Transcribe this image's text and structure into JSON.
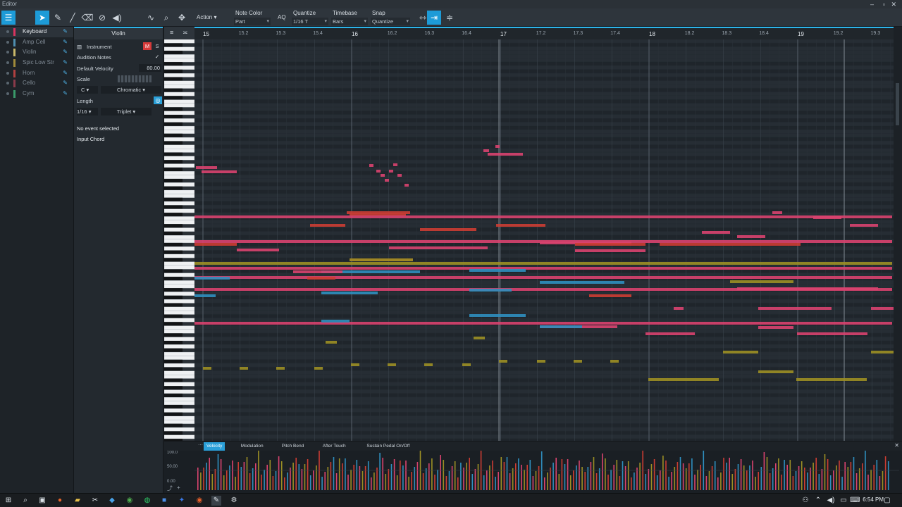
{
  "window": {
    "title": "Editor"
  },
  "toolbar": {
    "action_label": "Action",
    "note_color": {
      "label": "Note Color",
      "value": "Part"
    },
    "aq_label": "AQ",
    "quantize": {
      "label": "Quantize",
      "value": "1/16 T"
    },
    "timebase": {
      "label": "Timebase",
      "value": "Bars"
    },
    "snap": {
      "label": "Snap",
      "value": "Quantize"
    }
  },
  "tracks": [
    {
      "name": "Keyboard",
      "color": "#d9345f",
      "selected": true
    },
    {
      "name": "Amp Cell",
      "color": "#4f8fb0",
      "selected": false
    },
    {
      "name": "Violin",
      "color": "#c9b86a",
      "selected": false
    },
    {
      "name": "Spic Low Str",
      "color": "#a08a3a",
      "selected": false
    },
    {
      "name": "Horn",
      "color": "#b04040",
      "selected": false
    },
    {
      "name": "Cello",
      "color": "#8a3a4a",
      "selected": false
    },
    {
      "name": "Cym",
      "color": "#3a9a6a",
      "selected": false
    }
  ],
  "inspector": {
    "title": "Violin",
    "instrument_label": "Instrument",
    "mute": "M",
    "solo": "S",
    "audition_label": "Audition Notes",
    "audition_check": "✓",
    "velocity_label": "Default Velocity",
    "velocity_value": "80.00",
    "scale_label": "Scale",
    "scale_root": "C",
    "scale_type": "Chromatic",
    "length_label": "Length",
    "length_value": "1/16",
    "length_mode": "Triplet",
    "no_event": "No event selected",
    "input_chord": "Input Chord"
  },
  "ruler": {
    "bars": [
      "15",
      "16",
      "17",
      "18",
      "19"
    ],
    "beats": [
      "15.2",
      "15.3",
      "15.4",
      "16.2",
      "16.3",
      "16.4",
      "17.2",
      "17.3",
      "17.4",
      "18.2",
      "18.3",
      "18.4",
      "19.2",
      "19.3"
    ]
  },
  "lanes": {
    "tabs": [
      "Velocity",
      "Modulation",
      "Pitch Bend",
      "After Touch",
      "Sustain Pedal On/Off"
    ],
    "active": "Velocity",
    "scale_top": "100.0",
    "scale_mid": "50.00",
    "scale_bottom": "0.00"
  },
  "taskbar": {
    "time": "6:54 PM"
  },
  "colors": {
    "accent": "#2cb4ea",
    "note_pink": "#d9436f",
    "note_red": "#cc3d33",
    "note_blue": "#2f8fbf",
    "note_olive": "#9c8f24"
  }
}
